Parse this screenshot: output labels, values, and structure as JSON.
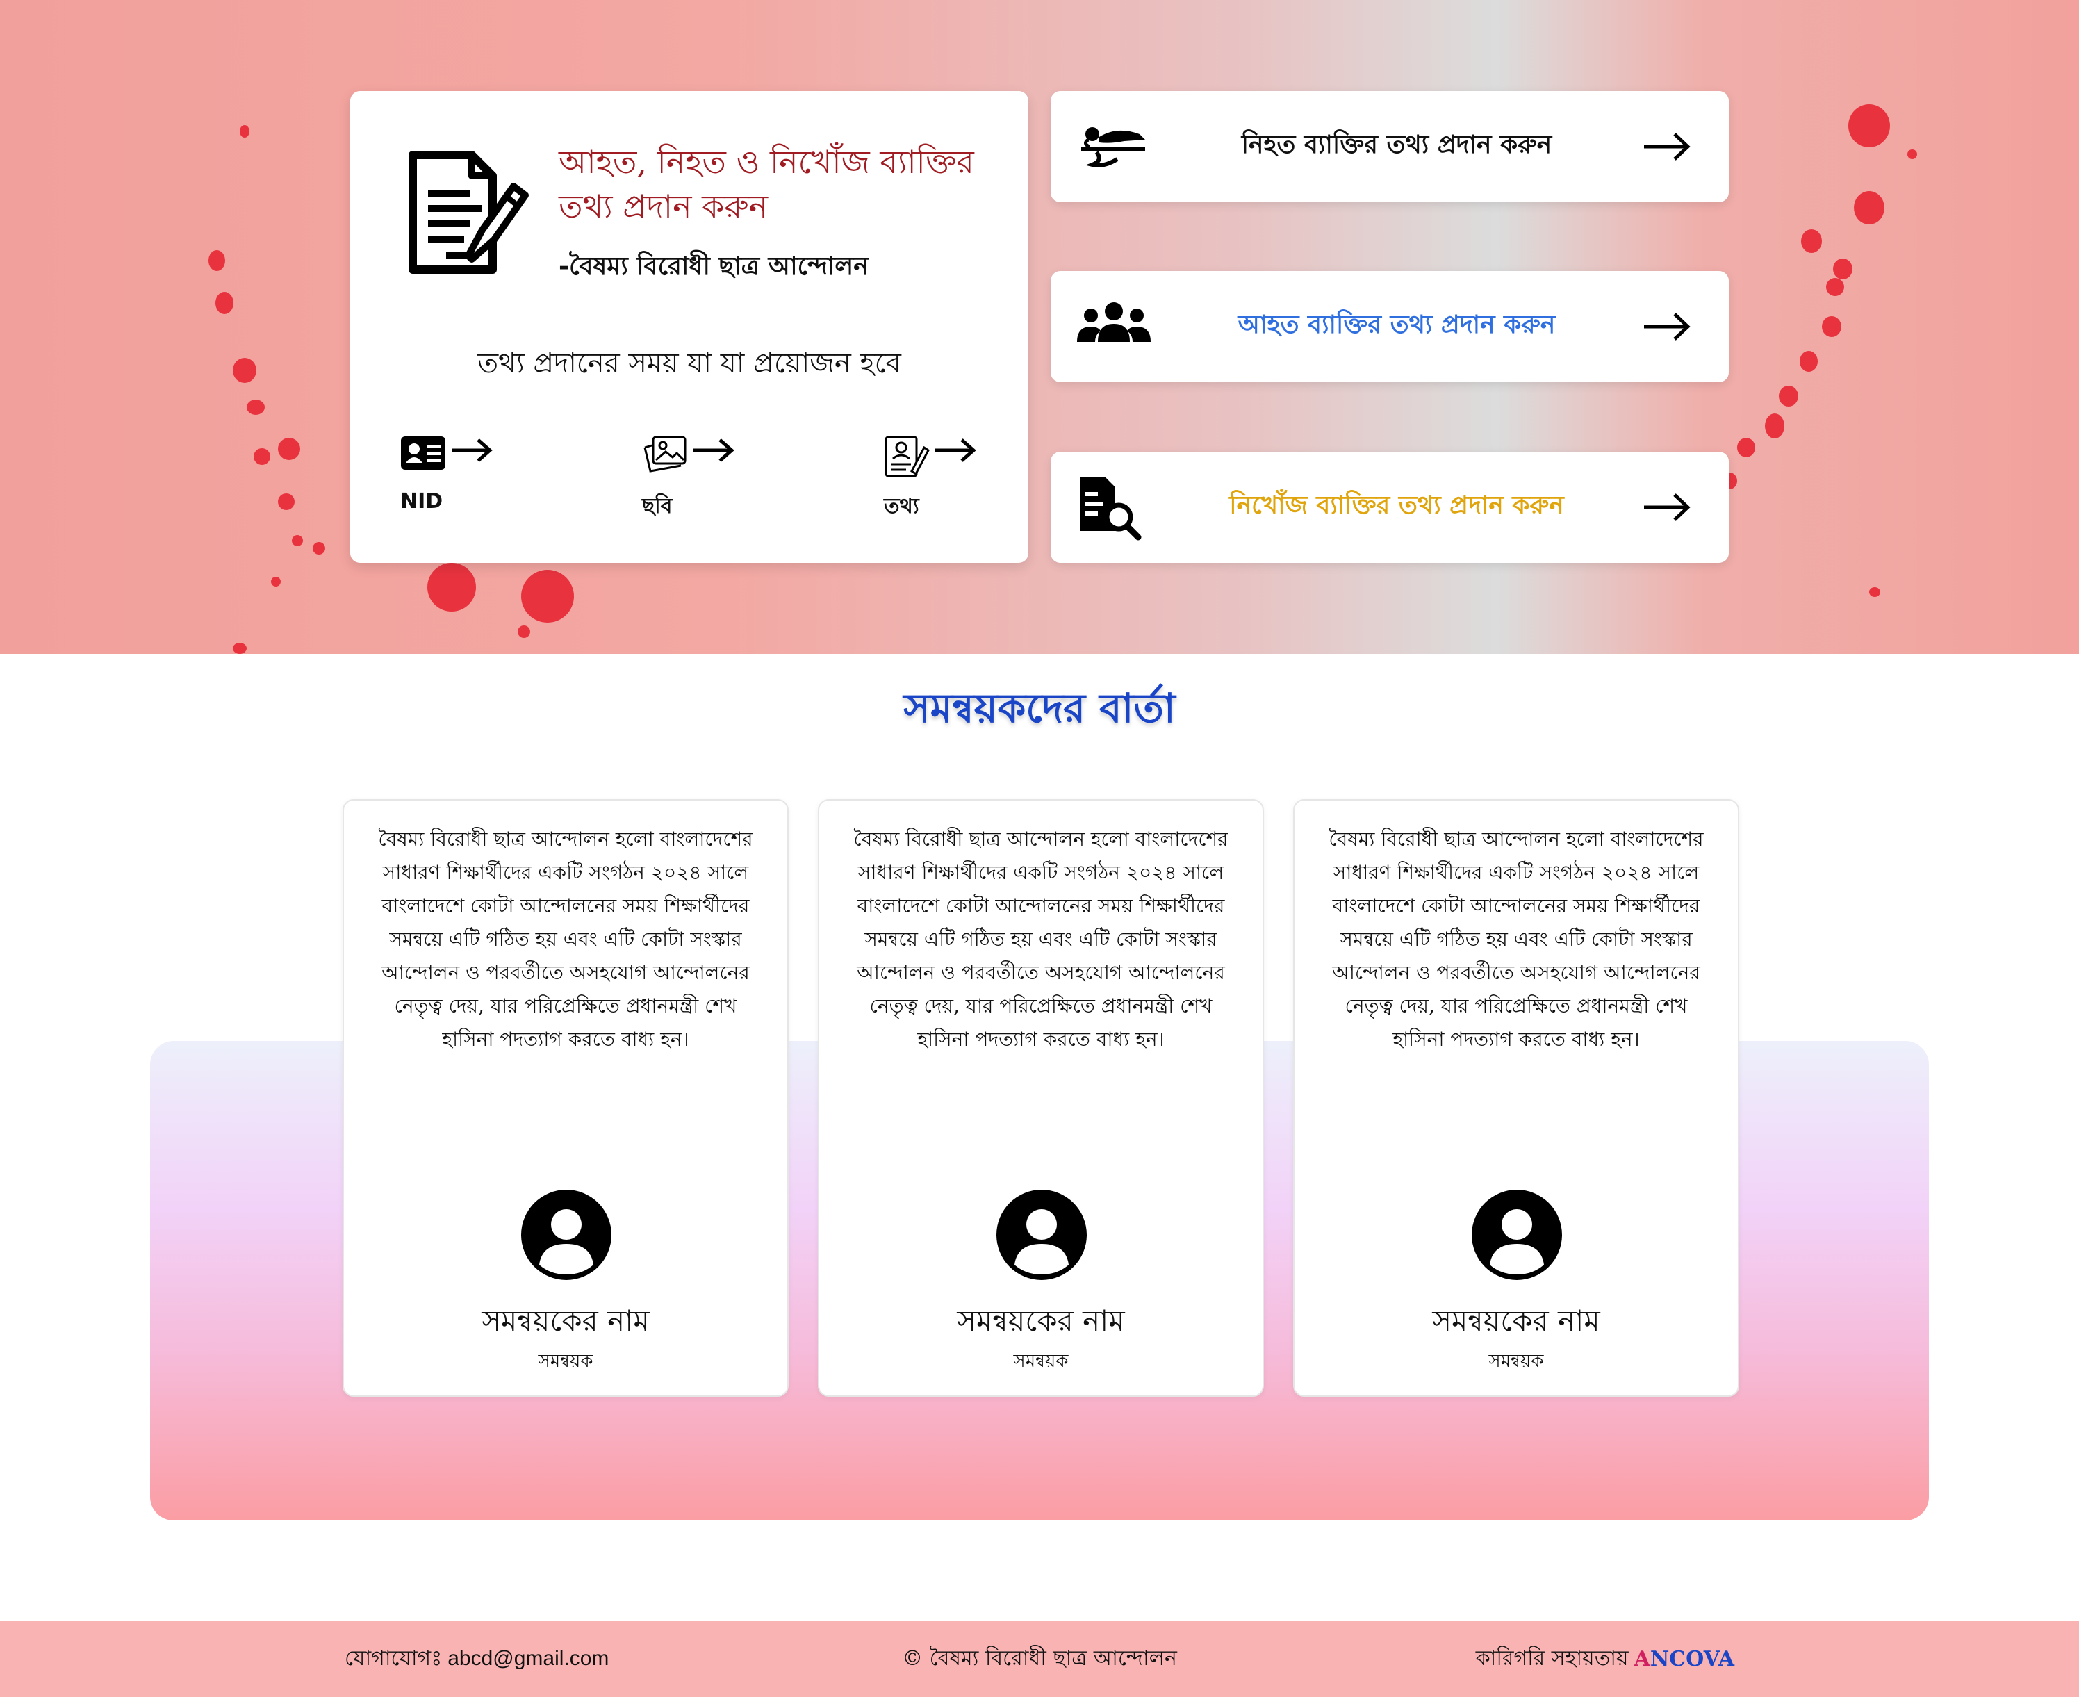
{
  "hero": {
    "card": {
      "title": "আহত, নিহত ও নিখোঁজ ব্যাক্তির তথ্য প্রদান করুন",
      "subtitle": "-বৈষম্য বিরোধী ছাত্র আন্দোলন",
      "requirements_heading": "তথ্য প্রদানের সময় যা যা প্রয়োজন হবে",
      "requirements": [
        {
          "label": "NID",
          "icon": "id-card-icon"
        },
        {
          "label": "ছবি",
          "icon": "photo-icon"
        },
        {
          "label": "তথ্য",
          "icon": "document-info-icon"
        }
      ]
    },
    "actions": [
      {
        "label": "নিহত ব্যাক্তির তথ্য প্রদান করুন",
        "icon": "deceased-person-icon",
        "color": "#111111"
      },
      {
        "label": "আহত ব্যাক্তির তথ্য প্রদান করুন",
        "icon": "people-group-icon",
        "color": "#2f6fe0"
      },
      {
        "label": "নিখোঁজ ব্যাক্তির তথ্য প্রদান করুন",
        "icon": "search-document-icon",
        "color": "#e0a40c"
      }
    ]
  },
  "coordinators": {
    "title": "সমন্বয়কদের বার্তা",
    "cards": [
      {
        "text": "বৈষম্য বিরোধী ছাত্র আন্দোলন হলো বাংলাদেশের সাধারণ শিক্ষার্থীদের একটি সংগঠন ২০২৪ সালে বাংলাদেশে কোটা আন্দোলনের সময় শিক্ষার্থীদের সমন্বয়ে এটি গঠিত হয় এবং এটি কোটা সংস্কার আন্দোলন ও পরবর্তীতে অসহযোগ আন্দোলনের নেতৃত্ব দেয়, যার পরিপ্রেক্ষিতে প্রধানমন্ত্রী শেখ হাসিনা পদত্যাগ করতে বাধ্য হন।",
        "name": "সমন্বয়কের নাম",
        "role": "সমন্বয়ক"
      },
      {
        "text": "বৈষম্য বিরোধী ছাত্র আন্দোলন হলো বাংলাদেশের সাধারণ শিক্ষার্থীদের একটি সংগঠন ২০২৪ সালে বাংলাদেশে কোটা আন্দোলনের সময় শিক্ষার্থীদের সমন্বয়ে এটি গঠিত হয় এবং এটি কোটা সংস্কার আন্দোলন ও পরবর্তীতে অসহযোগ আন্দোলনের নেতৃত্ব দেয়, যার পরিপ্রেক্ষিতে প্রধানমন্ত্রী শেখ হাসিনা পদত্যাগ করতে বাধ্য হন।",
        "name": "সমন্বয়কের নাম",
        "role": "সমন্বয়ক"
      },
      {
        "text": "বৈষম্য বিরোধী ছাত্র আন্দোলন হলো বাংলাদেশের সাধারণ শিক্ষার্থীদের একটি সংগঠন ২০২৪ সালে বাংলাদেশে কোটা আন্দোলনের সময় শিক্ষার্থীদের সমন্বয়ে এটি গঠিত হয় এবং এটি কোটা সংস্কার আন্দোলন ও পরবর্তীতে অসহযোগ আন্দোলনের নেতৃত্ব দেয়, যার পরিপ্রেক্ষিতে প্রধানমন্ত্রী শেখ হাসিনা পদত্যাগ করতে বাধ্য হন।",
        "name": "সমন্বয়কের নাম",
        "role": "সমন্বয়ক"
      }
    ]
  },
  "footer": {
    "contact_label": "যোগাযোগঃ",
    "contact_email": "abcd@gmail.com",
    "copyright": "© বৈষম্য বিরোধী ছাত্র আন্দোলন",
    "credit_label": "কারিগরি সহায়তায়",
    "brand_first": "A",
    "brand_rest": "NCOVA"
  },
  "colors": {
    "title_red": "#a01c22",
    "section_blue": "#1a45c7",
    "splash_red": "#e8333f",
    "footer_bg": "#f9b3b3"
  }
}
